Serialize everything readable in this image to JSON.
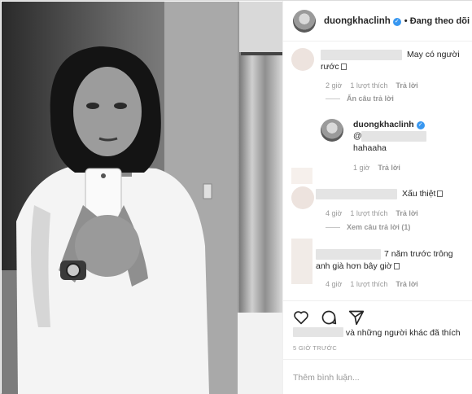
{
  "post": {
    "username": "duongkhaclinh",
    "separator": "•",
    "follow_label": "Đang theo dõi"
  },
  "comments": [
    {
      "text_line1": "May có người",
      "text_line2": "rước",
      "age": "2 giờ",
      "likes": "1 lượt thích",
      "reply_label": "Trả lời",
      "thread_label": "Ẩn câu trả lời"
    },
    {
      "username": "duongkhaclinh",
      "mention": "@",
      "text": "hahaaha",
      "age": "1 giờ",
      "reply_label": "Trả lời"
    },
    {
      "text": "Xấu thiệt",
      "age": "4 giờ",
      "likes": "1 lượt thích",
      "reply_label": "Trả lời",
      "thread_label": "Xem câu trả lời (1)"
    },
    {
      "text_line1": "7 năm trước trông",
      "text_line2": "anh già hơn bây giờ",
      "age": "4 giờ",
      "likes": "1 lượt thích",
      "reply_label": "Trả lời"
    }
  ],
  "likes_summary": "và những người khác đã thích",
  "timestamp": "5 GIỜ TRƯỚC",
  "comment_placeholder": "Thêm bình luận...",
  "icons": [
    "heart-icon",
    "comment-icon",
    "share-icon",
    "verified-badge-icon"
  ],
  "colors": {
    "verified": "#3897f0",
    "muted": "#999999",
    "text": "#262626"
  }
}
